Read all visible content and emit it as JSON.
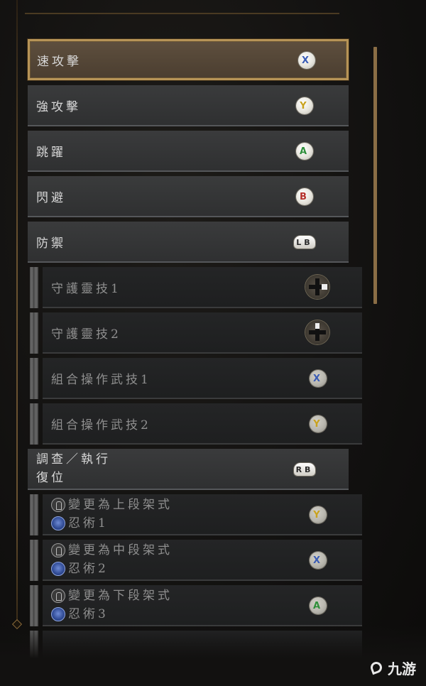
{
  "rows": [
    {
      "kind": "main",
      "label": "速攻擊",
      "button": "X",
      "button_color": "#3a5cb5",
      "selected": true
    },
    {
      "kind": "main",
      "label": "強攻擊",
      "button": "Y",
      "button_color": "#c9a21e"
    },
    {
      "kind": "main",
      "label": "跳躍",
      "button": "A",
      "button_color": "#2f8f3a"
    },
    {
      "kind": "main",
      "label": "閃避",
      "button": "B",
      "button_color": "#b5302a"
    },
    {
      "kind": "main",
      "label": "防禦",
      "button": "LB"
    },
    {
      "kind": "sub",
      "label": "守護靈技1",
      "button": "dpad",
      "dpad_dir": "right"
    },
    {
      "kind": "sub",
      "label": "守護靈技2",
      "button": "dpad",
      "dpad_dir": "up"
    },
    {
      "kind": "sub",
      "label": "組合操作武技1",
      "button": "X",
      "button_color": "#3a5cb5"
    },
    {
      "kind": "sub",
      "label": "組合操作武技2",
      "button": "Y",
      "button_color": "#c9a21e"
    },
    {
      "kind": "main",
      "label": "調查／執行",
      "label2": "復位",
      "button": "RB"
    },
    {
      "kind": "sub",
      "label": "變更為上段架式",
      "label2": "忍術1",
      "button": "Y",
      "button_color": "#c9a21e"
    },
    {
      "kind": "sub",
      "label": "變更為中段架式",
      "label2": "忍術2",
      "button": "X",
      "button_color": "#3a5cb5"
    },
    {
      "kind": "sub",
      "label": "變更為下段架式",
      "label2": "忍術3",
      "button": "A",
      "button_color": "#2f8f3a"
    }
  ],
  "watermark": {
    "text": "九游"
  }
}
